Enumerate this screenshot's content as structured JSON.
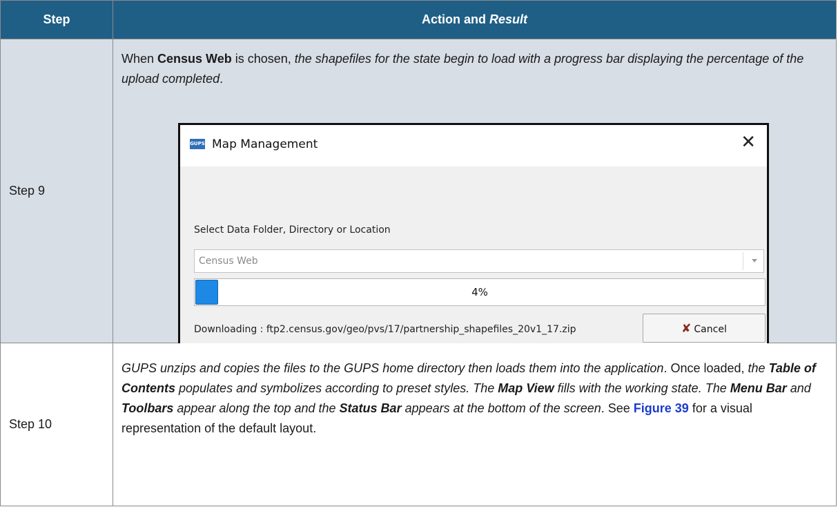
{
  "table": {
    "headers": {
      "step": "Step",
      "action_plain": "Action and ",
      "action_italic": "Result"
    },
    "rows": [
      {
        "step": "Step 9",
        "text": {
          "a": "When ",
          "b": "Census Web",
          "c": " is chosen, ",
          "d": "the shapefiles for the state begin to load with a progress bar displaying the percentage of the upload completed",
          "e": "."
        }
      },
      {
        "step": "Step 10",
        "text": {
          "s1": "GUPS unzips and copies the files to the GUPS home directory then loads them into the application",
          "s2": ". Once loaded, ",
          "s3": "the ",
          "s4": "Table of Contents",
          "s5": " populates and symbolizes according to preset styles. The ",
          "s6": "Map View",
          "s7": " fills with the working state. The ",
          "s8": "Menu Bar",
          "s9": " and ",
          "s10": "Toolbars",
          "s11": " appear along the top and the ",
          "s12": "Status Bar",
          "s13": " appears at the bottom of the screen",
          "s14": ". See ",
          "s15": "Figure 39",
          "s16": " for a visual representation of the default layout."
        }
      }
    ]
  },
  "dialog": {
    "logo_text": "GUPS",
    "title": "Map Management",
    "close_glyph": "✕",
    "select_label": "Select Data Folder, Directory or Location",
    "combo_value": "Census Web",
    "progress_value": 0.04,
    "progress_text": "4%",
    "status": "Downloading : ftp2.census.gov/geo/pvs/17/partnership_shapefiles_20v1_17.zip",
    "cancel_label": "Cancel",
    "cancel_icon": "✘"
  },
  "colors": {
    "header_bg": "#1f5f86",
    "step9_bg": "#d8dee6",
    "progress_fill": "#1e88e5",
    "link": "#1a3ccf"
  }
}
